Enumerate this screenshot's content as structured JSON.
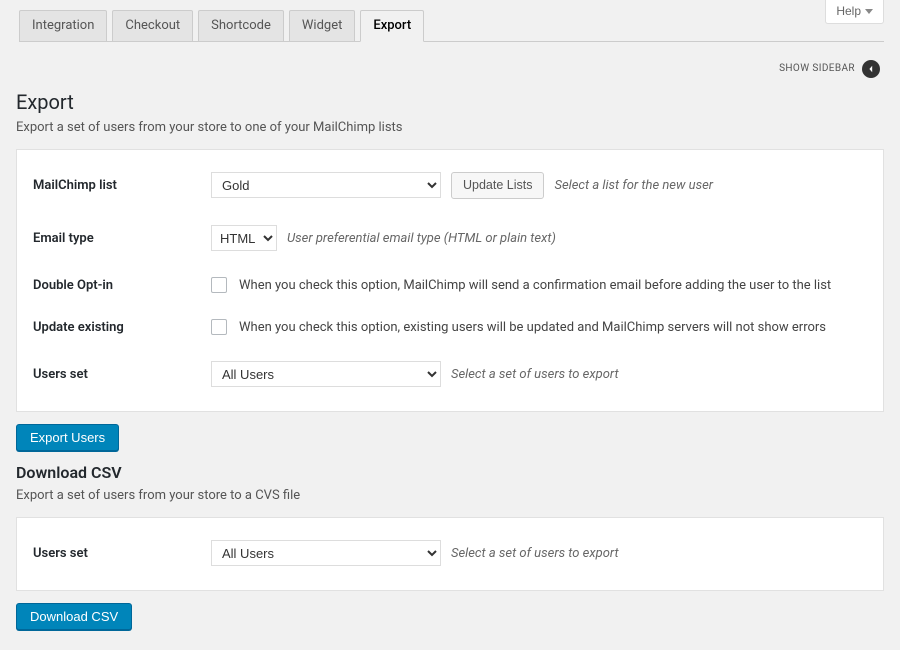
{
  "help": {
    "label": "Help"
  },
  "tabs": [
    {
      "label": "Integration"
    },
    {
      "label": "Checkout"
    },
    {
      "label": "Shortcode"
    },
    {
      "label": "Widget"
    },
    {
      "label": "Export"
    }
  ],
  "sidebar_toggle": {
    "label": "SHOW SIDEBAR"
  },
  "export": {
    "title": "Export",
    "desc": "Export a set of users from your store to one of your MailChimp lists",
    "mailchimp_list": {
      "label": "MailChimp list",
      "value": "Gold",
      "update_button": "Update Lists",
      "hint": "Select a list for the new user"
    },
    "email_type": {
      "label": "Email type",
      "value": "HTML",
      "hint": "User preferential email type (HTML or plain text)"
    },
    "double_optin": {
      "label": "Double Opt-in",
      "desc": "When you check this option, MailChimp will send a confirmation email before adding the user to the list"
    },
    "update_existing": {
      "label": "Update existing",
      "desc": "When you check this option, existing users will be updated and MailChimp servers will not show errors"
    },
    "users_set": {
      "label": "Users set",
      "value": "All Users",
      "hint": "Select a set of users to export"
    },
    "submit": "Export Users"
  },
  "csv": {
    "title": "Download CSV",
    "desc": "Export a set of users from your store to a CVS file",
    "users_set": {
      "label": "Users set",
      "value": "All Users",
      "hint": "Select a set of users to export"
    },
    "submit": "Download CSV"
  }
}
